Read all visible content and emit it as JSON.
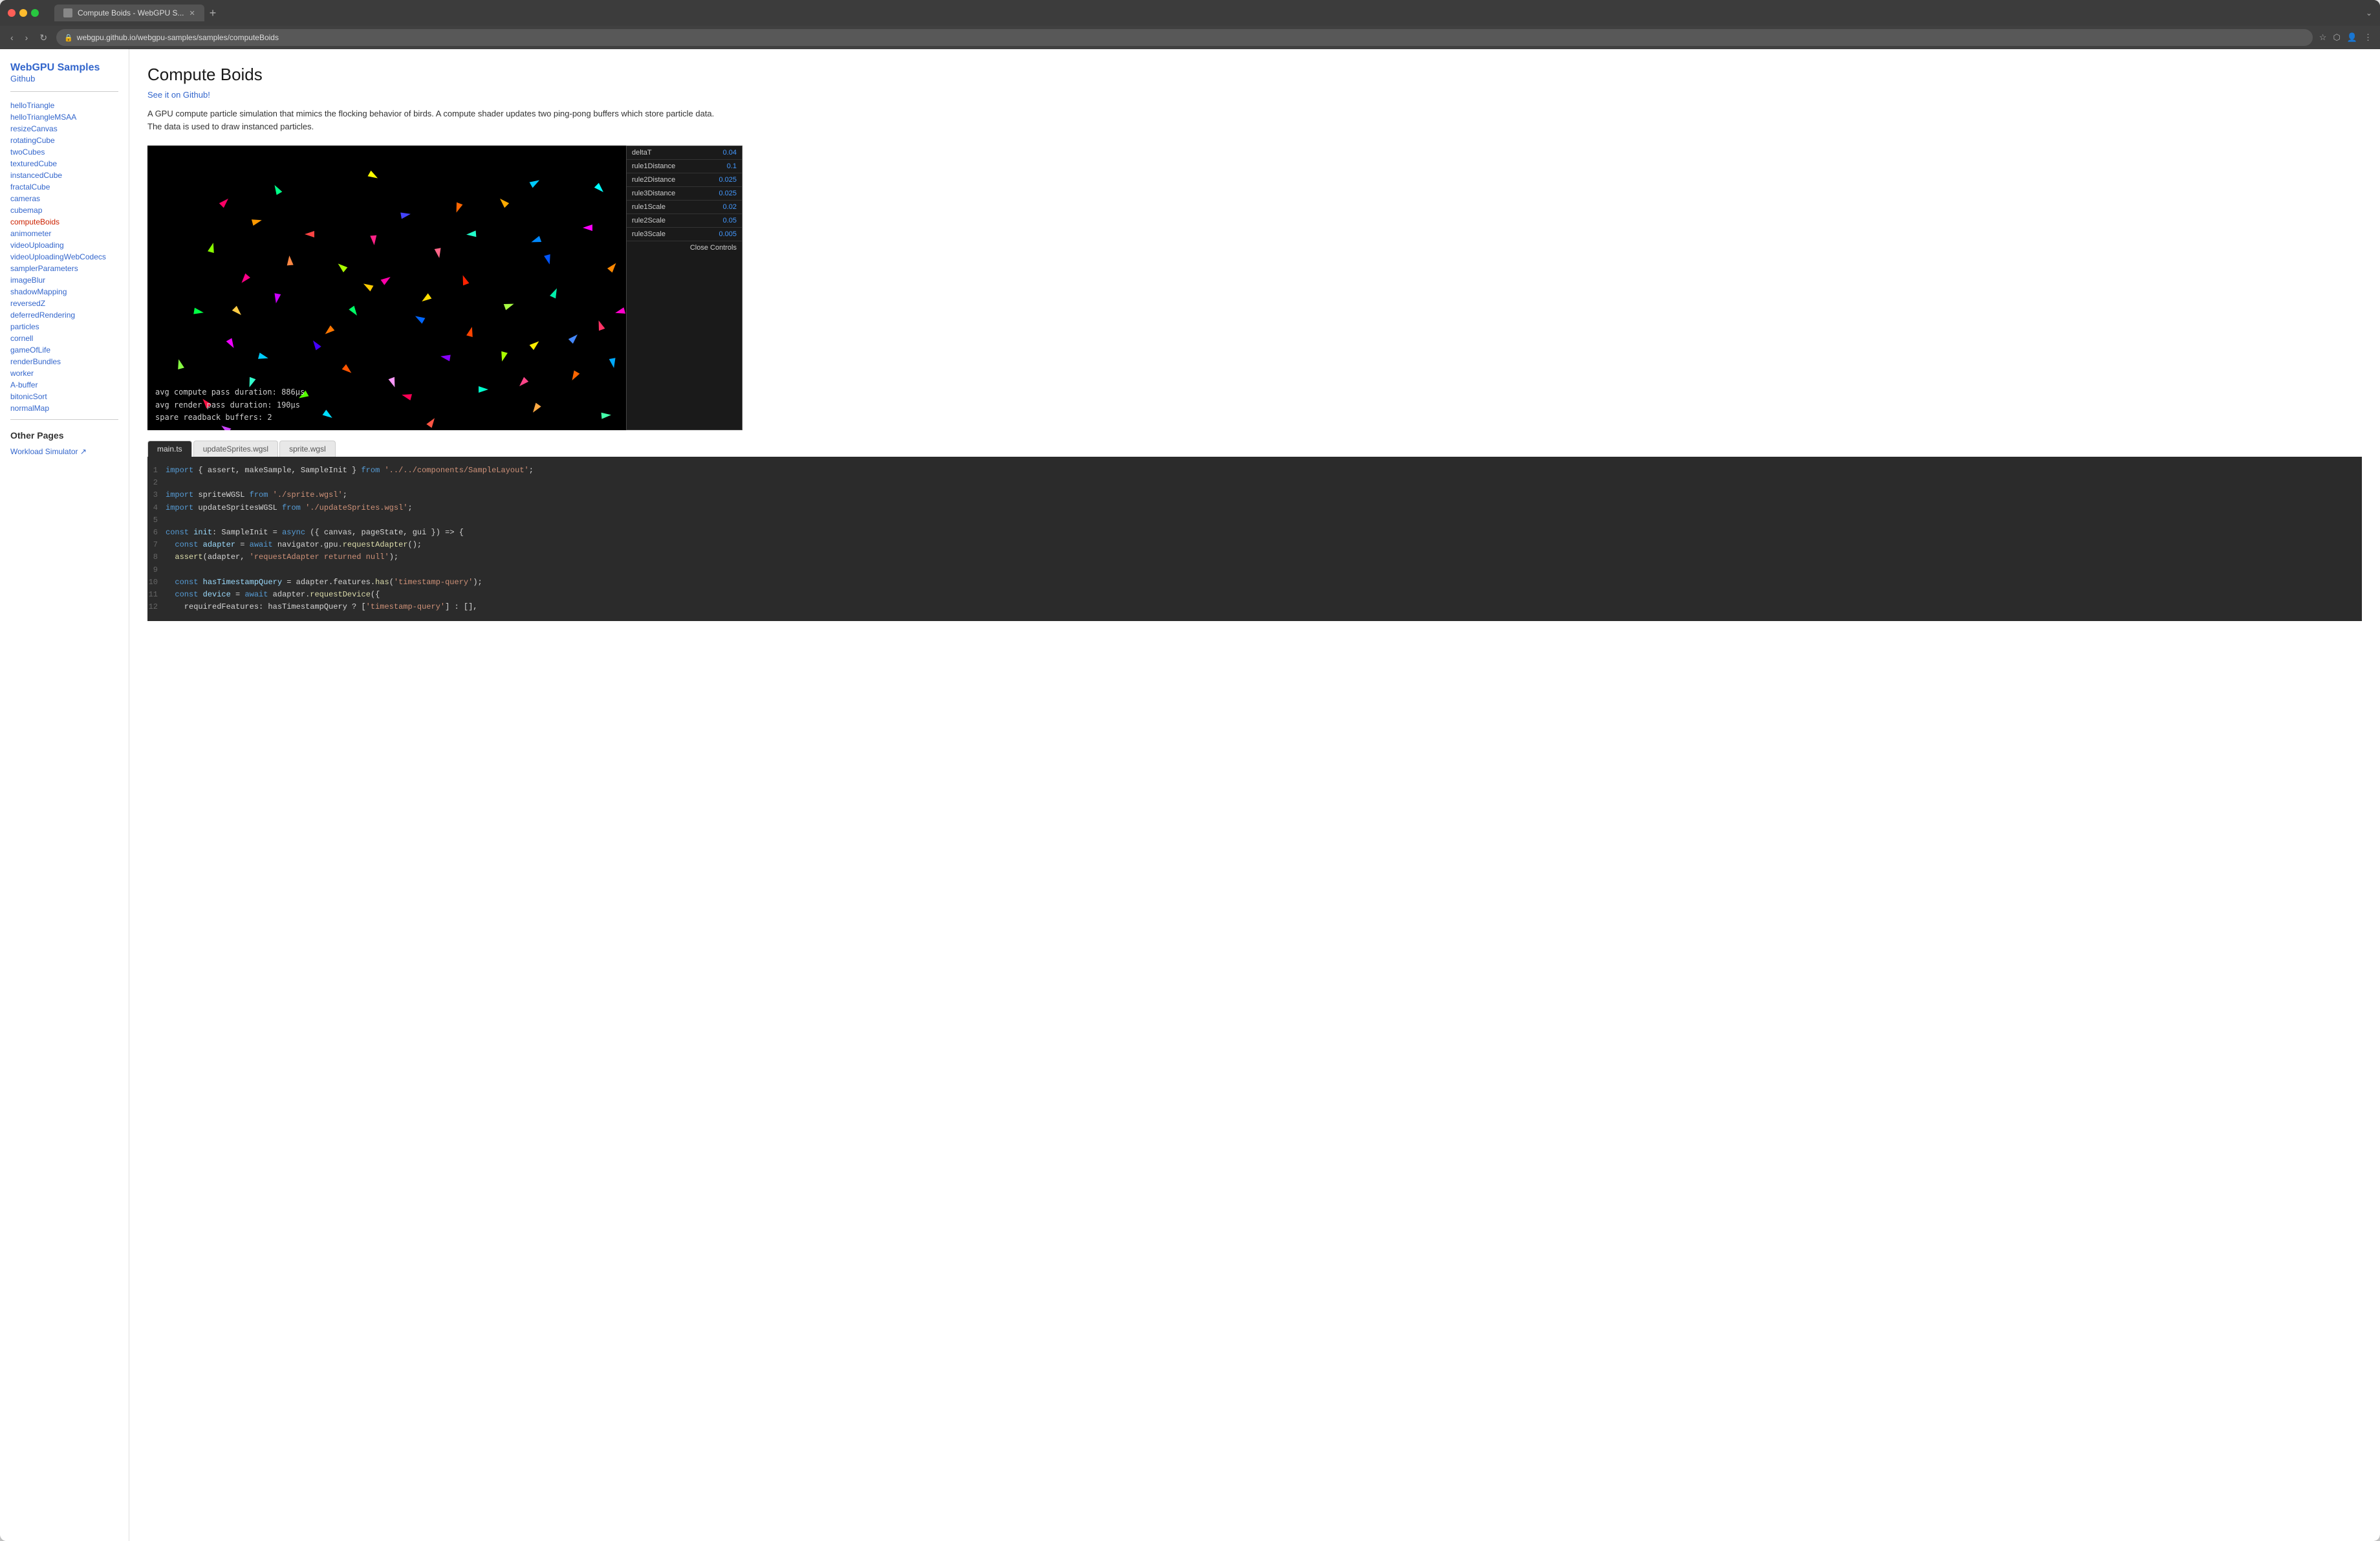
{
  "browser": {
    "tab_title": "Compute Boids - WebGPU S...",
    "url": "webgpu.github.io/webgpu-samples/samples/computeBoids",
    "new_tab_label": "+"
  },
  "sidebar": {
    "title": "WebGPU Samples",
    "github_label": "Github",
    "nav_items": [
      {
        "id": "helloTriangle",
        "label": "helloTriangle",
        "active": false
      },
      {
        "id": "helloTriangleMSAA",
        "label": "helloTriangleMSAA",
        "active": false
      },
      {
        "id": "resizeCanvas",
        "label": "resizeCanvas",
        "active": false
      },
      {
        "id": "rotatingCube",
        "label": "rotatingCube",
        "active": false
      },
      {
        "id": "twoCubes",
        "label": "twoCubes",
        "active": false
      },
      {
        "id": "texturedCube",
        "label": "texturedCube",
        "active": false
      },
      {
        "id": "instancedCube",
        "label": "instancedCube",
        "active": false
      },
      {
        "id": "fractalCube",
        "label": "fractalCube",
        "active": false
      },
      {
        "id": "cameras",
        "label": "cameras",
        "active": false
      },
      {
        "id": "cubemap",
        "label": "cubemap",
        "active": false
      },
      {
        "id": "computeBoids",
        "label": "computeBoids",
        "active": true
      },
      {
        "id": "animometer",
        "label": "animometer",
        "active": false
      },
      {
        "id": "videoUploading",
        "label": "videoUploading",
        "active": false
      },
      {
        "id": "videoUploadingWebCodecs",
        "label": "videoUploadingWebCodecs",
        "active": false
      },
      {
        "id": "samplerParameters",
        "label": "samplerParameters",
        "active": false
      },
      {
        "id": "imageBlur",
        "label": "imageBlur",
        "active": false
      },
      {
        "id": "shadowMapping",
        "label": "shadowMapping",
        "active": false
      },
      {
        "id": "reversedZ",
        "label": "reversedZ",
        "active": false
      },
      {
        "id": "deferredRendering",
        "label": "deferredRendering",
        "active": false
      },
      {
        "id": "particles",
        "label": "particles",
        "active": false
      },
      {
        "id": "cornell",
        "label": "cornell",
        "active": false
      },
      {
        "id": "gameOfLife",
        "label": "gameOfLife",
        "active": false
      },
      {
        "id": "renderBundles",
        "label": "renderBundles",
        "active": false
      },
      {
        "id": "worker",
        "label": "worker",
        "active": false
      },
      {
        "id": "A-buffer",
        "label": "A-buffer",
        "active": false
      },
      {
        "id": "bitonicSort",
        "label": "bitonicSort",
        "active": false
      },
      {
        "id": "normalMap",
        "label": "normalMap",
        "active": false
      }
    ],
    "other_pages_title": "Other Pages",
    "other_links": [
      {
        "label": "Workload Simulator ↗"
      }
    ]
  },
  "main": {
    "title": "Compute Boids",
    "github_link_label": "See it on Github!",
    "description": "A GPU compute particle simulation that mimics the flocking behavior of birds. A compute shader updates two ping-pong buffers which store particle data. The data is used to draw instanced particles.",
    "stats": {
      "compute_label": "avg compute pass duration:",
      "compute_value": "886μs",
      "render_label": "avg render pass duration:",
      "render_value": "190μs",
      "spare_label": "spare readback buffers:",
      "spare_value": "2"
    },
    "controls": {
      "rows": [
        {
          "label": "deltaT",
          "value": "0.04"
        },
        {
          "label": "rule1Distance",
          "value": "0.1"
        },
        {
          "label": "rule2Distance",
          "value": "0.025"
        },
        {
          "label": "rule3Distance",
          "value": "0.025"
        },
        {
          "label": "rule1Scale",
          "value": "0.02"
        },
        {
          "label": "rule2Scale",
          "value": "0.05"
        },
        {
          "label": "rule3Scale",
          "value": "0.005"
        }
      ],
      "close_btn_label": "Close Controls"
    },
    "tabs": [
      {
        "id": "main_ts",
        "label": "main.ts",
        "active": true
      },
      {
        "id": "update_sprites",
        "label": "updateSprites.wgsl",
        "active": false
      },
      {
        "id": "sprite_wgsl",
        "label": "sprite.wgsl",
        "active": false
      }
    ],
    "code_lines": [
      {
        "num": "1",
        "content": "import { assert, makeSample, SampleInit } from '../../components/SampleLayout';"
      },
      {
        "num": "2",
        "content": ""
      },
      {
        "num": "3",
        "content": "import spriteWGSL from './sprite.wgsl';"
      },
      {
        "num": "4",
        "content": "import updateSpritesWGSL from './updateSprites.wgsl';"
      },
      {
        "num": "5",
        "content": ""
      },
      {
        "num": "6",
        "content": "const init: SampleInit = async ({ canvas, pageState, gui }) => {"
      },
      {
        "num": "7",
        "content": "  const adapter = await navigator.gpu.requestAdapter();"
      },
      {
        "num": "8",
        "content": "  assert(adapter, 'requestAdapter returned null');"
      },
      {
        "num": "9",
        "content": ""
      },
      {
        "num": "10",
        "content": "  const hasTimestampQuery = adapter.features.has('timestamp-query');"
      },
      {
        "num": "11",
        "content": "  const device = await adapter.requestDevice({"
      },
      {
        "num": "12",
        "content": "    requiredFeatures: hasTimestampQuery ? ['timestamp-query'] : [],"
      }
    ]
  }
}
